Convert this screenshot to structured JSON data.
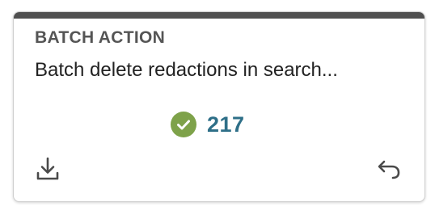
{
  "card": {
    "type_label": "BATCH ACTION",
    "title": "Batch delete redactions in search...",
    "status": {
      "icon": "check-circle-icon",
      "color": "#7ea24a",
      "count": "217",
      "count_color": "#2e6f88"
    },
    "actions": [
      {
        "icon": "download-icon"
      },
      {
        "icon": "undo-icon"
      }
    ],
    "accent_color": "#4f4f4f"
  }
}
